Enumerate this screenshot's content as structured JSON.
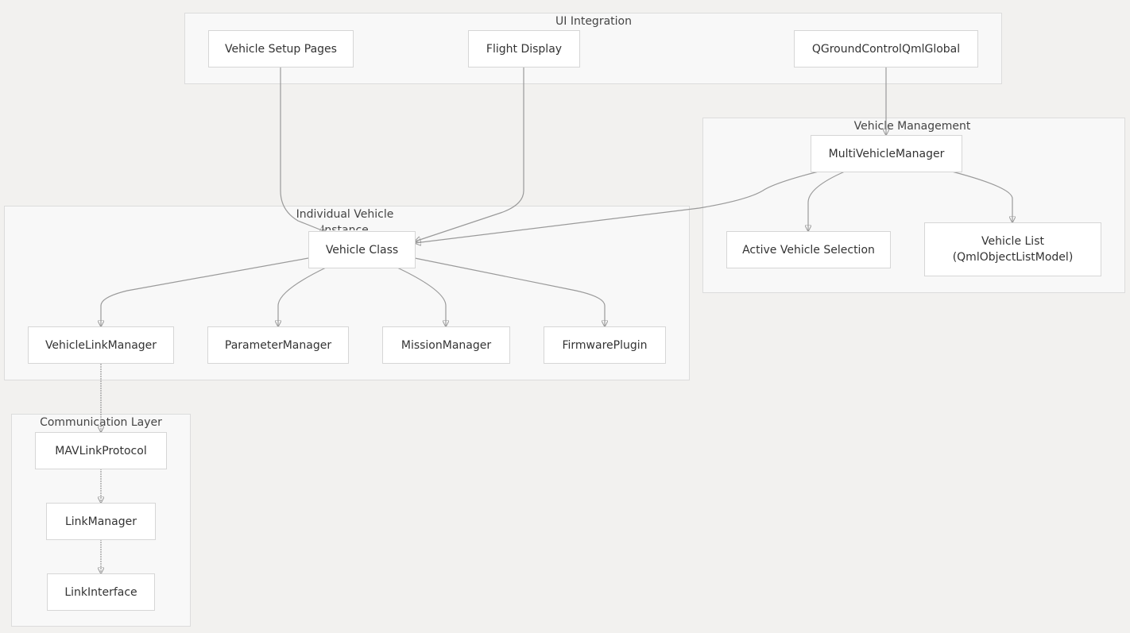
{
  "clusters": {
    "ui_integration": "UI Integration",
    "vehicle_management": "Vehicle Management",
    "individual_vehicle": "Individual Vehicle\nInstance",
    "communication_layer": "Communication Layer"
  },
  "nodes": {
    "vehicle_setup_pages": "Vehicle Setup Pages",
    "flight_display": "Flight Display",
    "qgc_qml_global": "QGroundControlQmlGlobal",
    "multi_vehicle_manager": "MultiVehicleManager",
    "active_vehicle_selection": "Active Vehicle Selection",
    "vehicle_list": "Vehicle List\n(QmlObjectListModel)",
    "vehicle_class": "Vehicle Class",
    "vehicle_link_manager": "VehicleLinkManager",
    "parameter_manager": "ParameterManager",
    "mission_manager": "MissionManager",
    "firmware_plugin": "FirmwarePlugin",
    "mavlink_protocol": "MAVLinkProtocol",
    "link_manager": "LinkManager",
    "link_interface": "LinkInterface"
  },
  "colors": {
    "background": "#f2f1ef",
    "cluster_fill": "#f8f8f8",
    "node_fill": "#ffffff",
    "edge": "#9a9a9a"
  }
}
